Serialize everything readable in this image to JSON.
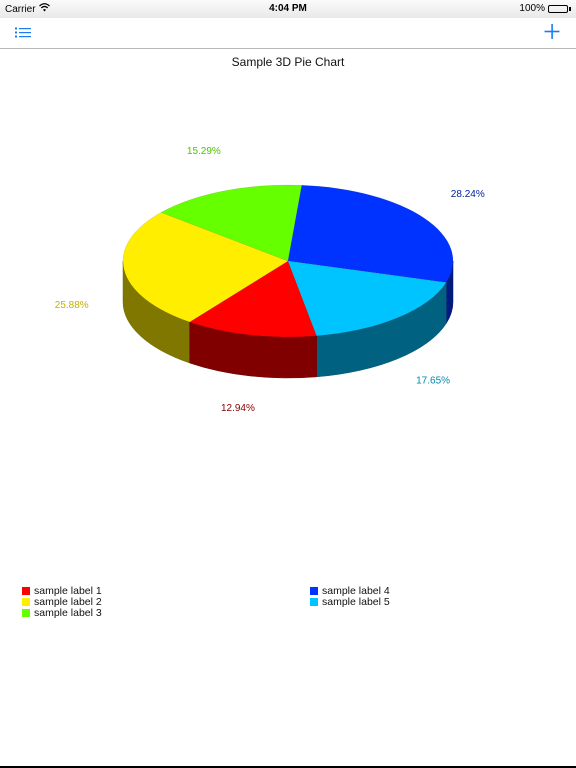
{
  "status_bar": {
    "carrier": "Carrier",
    "time": "4:04 PM",
    "battery": "100%"
  },
  "nav": {
    "menu_icon": "list-icon",
    "add_icon": "plus-icon",
    "accent_color": "#1a7cf0"
  },
  "chart_data": {
    "type": "pie",
    "style": "3d",
    "title": "Sample 3D Pie Chart",
    "categories": [
      "sample label 1",
      "sample label 2",
      "sample label 3",
      "sample label 4",
      "sample label 5"
    ],
    "values": [
      12.94,
      25.88,
      15.29,
      28.24,
      17.65
    ],
    "labels": [
      "12.94%",
      "25.88%",
      "15.29%",
      "28.24%",
      "17.65%"
    ],
    "colors": [
      "#ff0000",
      "#ffee00",
      "#66ff00",
      "#0033ff",
      "#00c4ff"
    ],
    "label_colors": [
      "#8a0000",
      "#c4b000",
      "#4fc400",
      "#001f9c",
      "#0088b0"
    ],
    "legend_position": "bottom"
  }
}
